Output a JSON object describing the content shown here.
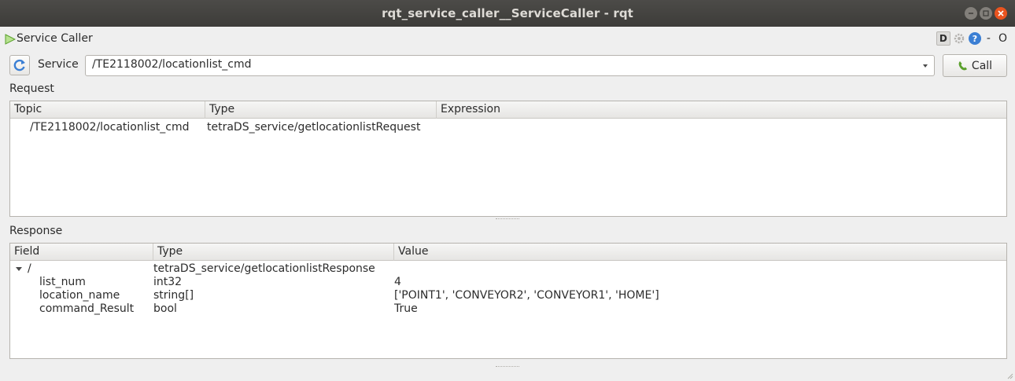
{
  "window": {
    "title": "rqt_service_caller__ServiceCaller - rqt"
  },
  "plugin": {
    "title": "Service Caller",
    "ctrl_d": "D",
    "ctrl_dash": "-",
    "ctrl_o": "O"
  },
  "service": {
    "label": "Service",
    "selected": "/TE2118002/locationlist_cmd",
    "call_label": "Call"
  },
  "request": {
    "section_label": "Request",
    "columns": [
      "Topic",
      "Type",
      "Expression"
    ],
    "rows": [
      {
        "topic": "/TE2118002/locationlist_cmd",
        "type": "tetraDS_service/getlocationlistRequest",
        "expression": ""
      }
    ]
  },
  "response": {
    "section_label": "Response",
    "columns": [
      "Field",
      "Type",
      "Value"
    ],
    "root": {
      "field": "/",
      "type": "tetraDS_service/getlocationlistResponse",
      "value": ""
    },
    "rows": [
      {
        "field": "list_num",
        "type": "int32",
        "value": "4"
      },
      {
        "field": "location_name",
        "type": "string[]",
        "value": "['POINT1', 'CONVEYOR2', 'CONVEYOR1', 'HOME']"
      },
      {
        "field": "command_Result",
        "type": "bool",
        "value": "True"
      }
    ]
  },
  "colors": {
    "titlebar": "#3d3c39",
    "close_button": "#e9541f",
    "refresh_icon": "#3b7fd4",
    "call_icon": "#5aa02c",
    "plugin_arrow": "#5aa02c"
  },
  "icons": {
    "plugin": "play-icon",
    "refresh": "refresh-icon",
    "call": "phone-icon",
    "help": "help-icon",
    "settings": "gear-icon",
    "dropdown": "chevron-down-icon"
  }
}
